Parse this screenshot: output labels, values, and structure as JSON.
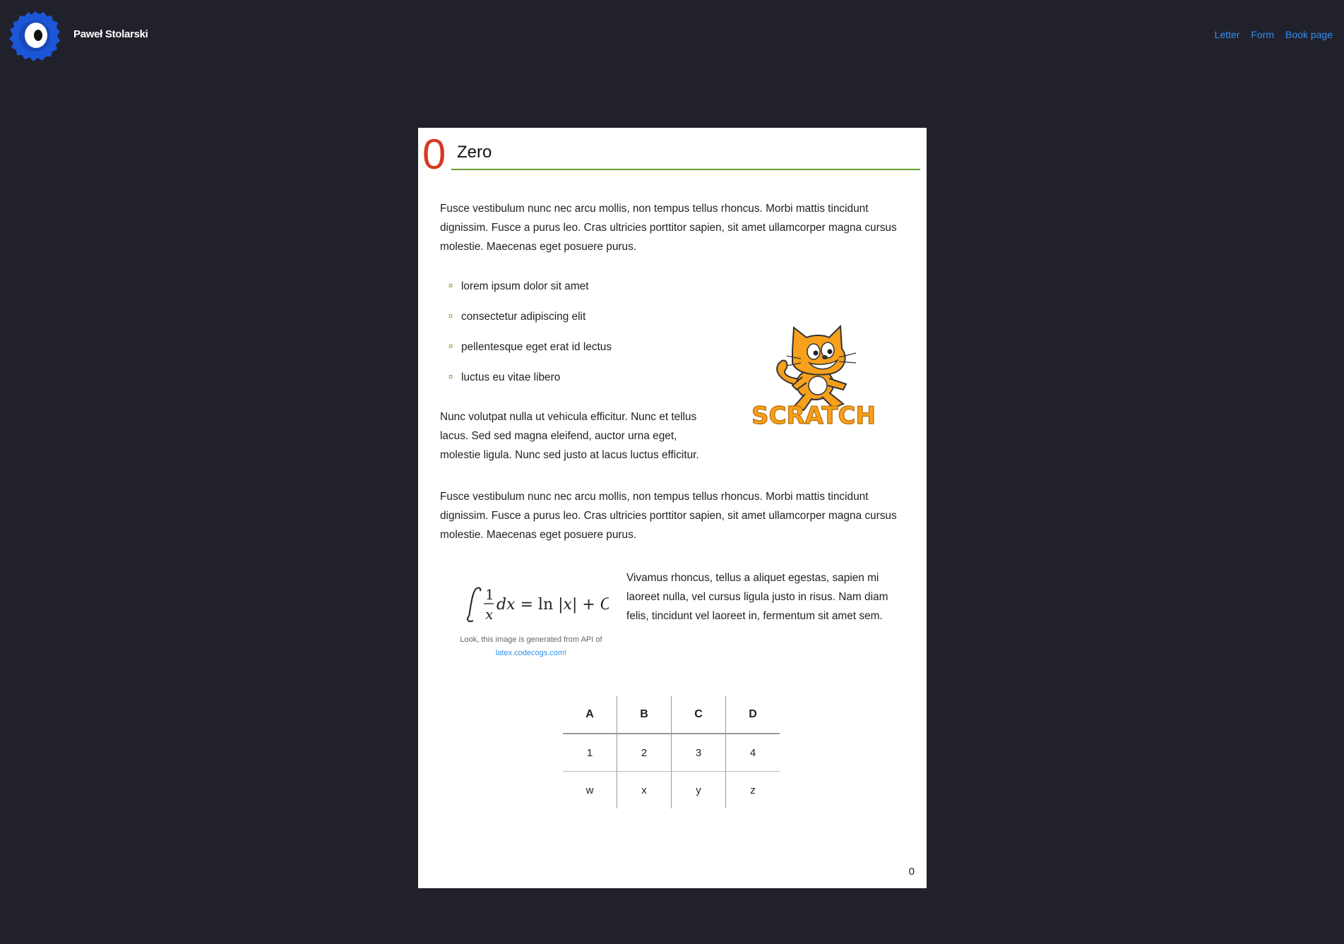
{
  "header": {
    "brand": "Paweł Stolarski",
    "nav": [
      "Letter",
      "Form",
      "Book page"
    ]
  },
  "chapter": {
    "number": "0",
    "title": "Zero"
  },
  "body": {
    "para1": "Fusce vestibulum nunc nec arcu mollis, non tempus tellus rhoncus. Morbi mattis tincidunt dignissim. Fusce a purus leo. Cras ultricies porttitor sapien, sit amet ullamcorper magna cursus molestie. Maecenas eget posuere purus.",
    "list": [
      "lorem ipsum dolor sit amet",
      "consectetur adipiscing elit",
      "pellentesque eget erat id lectus",
      "luctus eu vitae libero"
    ],
    "bullet_glyph": "¤",
    "para2": "Nunc volutpat nulla ut vehicula efficitur. Nunc et tellus lacus. Sed sed magna eleifend, auctor urna eget, molestie ligula. Nunc sed justo at lacus luctus efficitur.",
    "para3": "Fusce vestibulum nunc nec arcu mollis, non tempus tellus rhoncus. Morbi mattis tincidunt dignissim. Fusce a purus leo. Cras ultricies porttitor sapien, sit amet ullamcorper magna cursus molestie. Maecenas eget posuere purus.",
    "para4": "Vivamus rhoncus, tellus a aliquet egestas, sapien mi laoreet nulla, vel cursus ligula justo in risus. Nam diam felis, tincidunt vel laoreet in, fermentum sit amet sem.",
    "image_text": "SCRATCH",
    "caption_text": "Look, this image is generated from API of",
    "caption_link": "latex.codecogs.com!"
  },
  "table": {
    "headers": [
      "A",
      "B",
      "C",
      "D"
    ],
    "rows": [
      [
        "1",
        "2",
        "3",
        "4"
      ],
      [
        "w",
        "x",
        "y",
        "z"
      ]
    ]
  },
  "page_number": "0",
  "colors": {
    "background": "#21212c",
    "link": "#2f8ff0",
    "chapter_number": "#d63a23",
    "rule": "#6a9e2a"
  }
}
